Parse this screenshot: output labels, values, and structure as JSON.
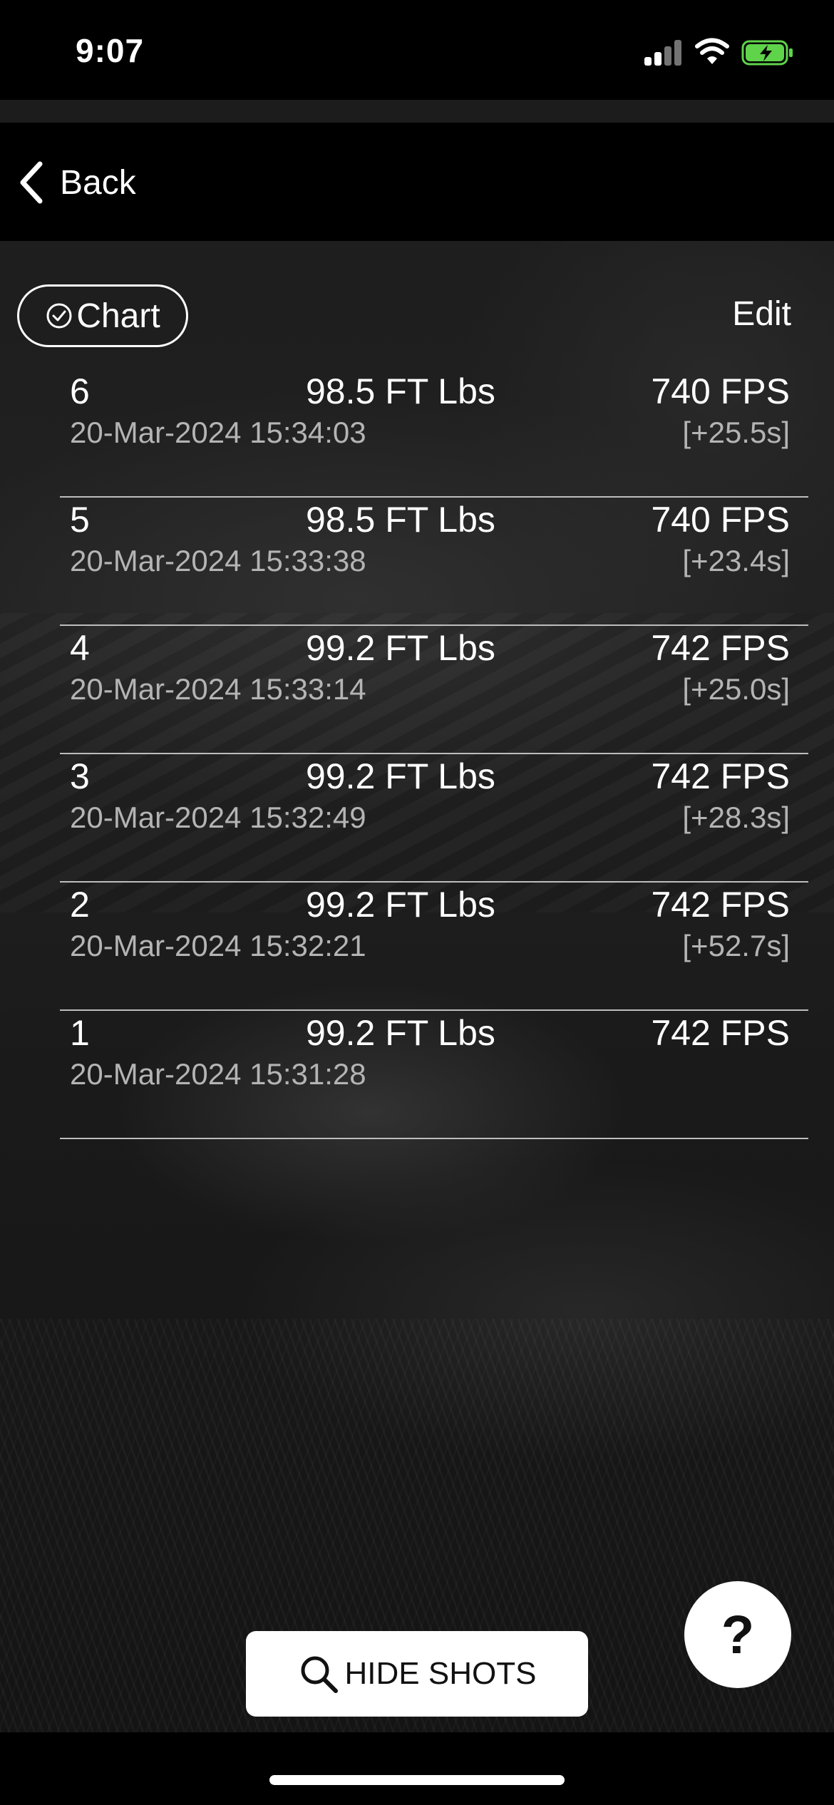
{
  "status_bar": {
    "time": "9:07"
  },
  "nav": {
    "back_label": "Back"
  },
  "toolbar": {
    "chart_label": "Chart",
    "edit_label": "Edit"
  },
  "shots": [
    {
      "number": "6",
      "energy": "98.5 FT Lbs",
      "fps": "740 FPS",
      "timestamp": "20-Mar-2024 15:34:03",
      "delta": "[+25.5s]"
    },
    {
      "number": "5",
      "energy": "98.5 FT Lbs",
      "fps": "740 FPS",
      "timestamp": "20-Mar-2024 15:33:38",
      "delta": "[+23.4s]"
    },
    {
      "number": "4",
      "energy": "99.2 FT Lbs",
      "fps": "742 FPS",
      "timestamp": "20-Mar-2024 15:33:14",
      "delta": "[+25.0s]"
    },
    {
      "number": "3",
      "energy": "99.2 FT Lbs",
      "fps": "742 FPS",
      "timestamp": "20-Mar-2024 15:32:49",
      "delta": "[+28.3s]"
    },
    {
      "number": "2",
      "energy": "99.2 FT Lbs",
      "fps": "742 FPS",
      "timestamp": "20-Mar-2024 15:32:21",
      "delta": "[+52.7s]"
    },
    {
      "number": "1",
      "energy": "99.2 FT Lbs",
      "fps": "742 FPS",
      "timestamp": "20-Mar-2024 15:31:28",
      "delta": ""
    }
  ],
  "bottom": {
    "hide_shots_label": "HIDE SHOTS",
    "help_label": "?"
  },
  "icons": {
    "back": "chevron-left-icon",
    "chart": "check-circle-icon",
    "hide_shots": "search-icon",
    "battery": "battery-charging-icon"
  },
  "colors": {
    "background": "#000000",
    "battery_fill": "#5fd34a",
    "secondary_text": "#b4b4b4"
  }
}
